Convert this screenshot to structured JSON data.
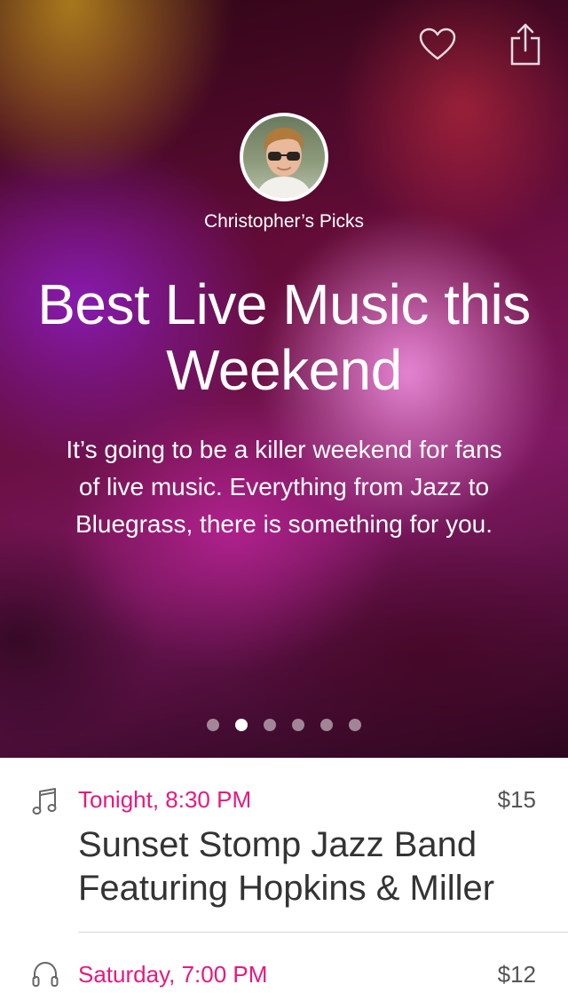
{
  "hero": {
    "curator": "Christopher’s Picks",
    "title": "Best Live Music this Weekend",
    "description": "It’s going to be a killer weekend for fans of live music. Everything from Jazz to Bluegrass, there is something for you.",
    "page_count": 6,
    "active_page": 2,
    "icons": {
      "like": "heart-icon",
      "share": "share-icon"
    }
  },
  "events": [
    {
      "icon": "music-note-icon",
      "time": "Tonight, 8:30 PM",
      "price": "$15",
      "name": "Sunset Stomp Jazz Band Featuring Hopkins & Miller"
    },
    {
      "icon": "headphones-icon",
      "time": "Saturday, 7:00 PM",
      "price": "$12",
      "name": ""
    }
  ],
  "colors": {
    "accent": "#e6197d",
    "event_name": "#333333",
    "price": "#555555",
    "divider": "#d6d6d6"
  }
}
